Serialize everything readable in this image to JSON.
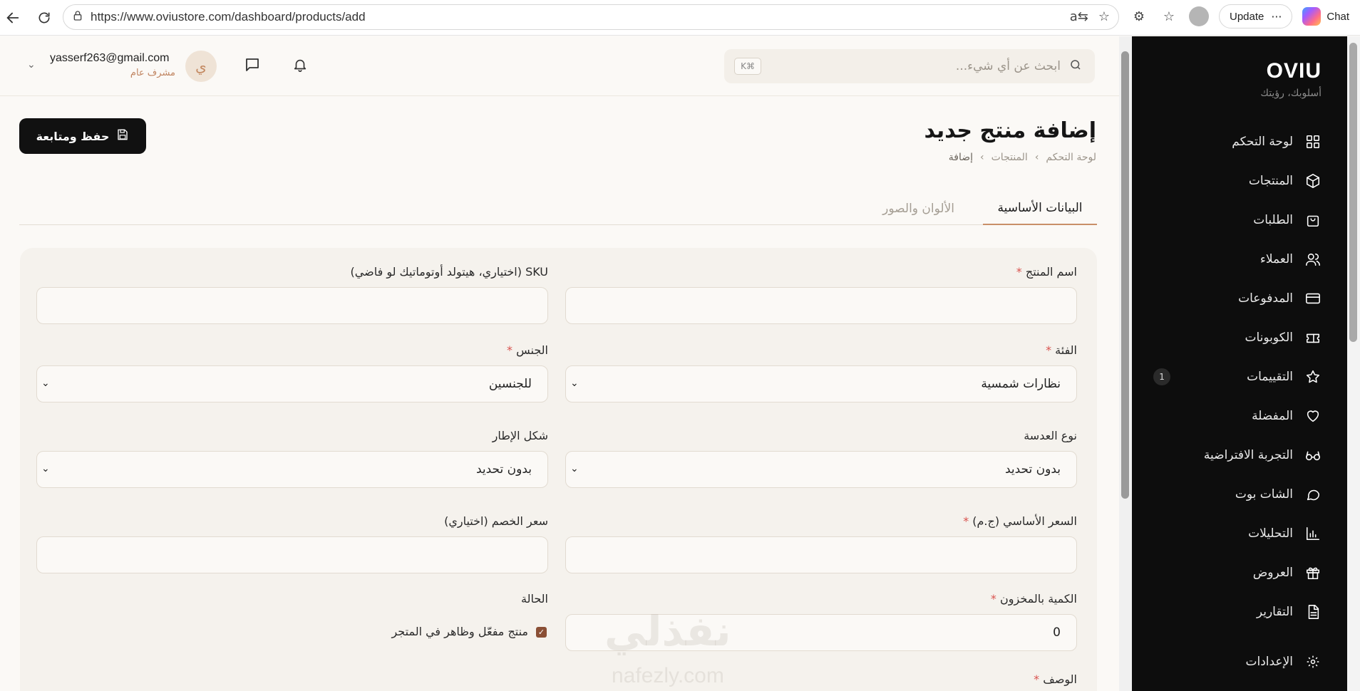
{
  "browser": {
    "url": "https://www.oviustore.com/dashboard/products/add",
    "update_label": "Update",
    "chat_label": "Chat"
  },
  "sidebar": {
    "brand": "OVIU",
    "tagline": "أسلوبك، رؤيتك",
    "items": [
      {
        "label": "لوحة التحكم",
        "icon": "grid-icon"
      },
      {
        "label": "المنتجات",
        "icon": "box-icon"
      },
      {
        "label": "الطلبات",
        "icon": "bag-icon"
      },
      {
        "label": "العملاء",
        "icon": "users-icon"
      },
      {
        "label": "المدفوعات",
        "icon": "card-icon"
      },
      {
        "label": "الكوبونات",
        "icon": "ticket-icon"
      },
      {
        "label": "التقييمات",
        "icon": "star-icon",
        "badge": "1"
      },
      {
        "label": "المفضلة",
        "icon": "heart-icon"
      },
      {
        "label": "التجربة الافتراضية",
        "icon": "glasses-icon"
      },
      {
        "label": "الشات بوت",
        "icon": "chat-icon"
      },
      {
        "label": "التحليلات",
        "icon": "bar-chart-icon"
      },
      {
        "label": "العروض",
        "icon": "gift-icon"
      },
      {
        "label": "التقارير",
        "icon": "file-icon"
      }
    ],
    "settings_label": "الإعدادات"
  },
  "topbar": {
    "search_placeholder": "ابحث عن أي شيء...",
    "kbd": "⌘K",
    "user_initial": "ي",
    "user_email": "yasserf263@gmail.com",
    "user_role": "مشرف عام"
  },
  "page": {
    "title": "إضافة منتج جديد",
    "breadcrumb": [
      "لوحة التحكم",
      "المنتجات",
      "إضافة"
    ],
    "save_label": "حفظ ومتابعة"
  },
  "tabs": {
    "basic": "البيانات الأساسية",
    "colors": "الألوان والصور"
  },
  "form": {
    "product_name_label": "اسم المنتج",
    "sku_label": "SKU (اختياري، هيتولد أوتوماتيك لو فاضي)",
    "category_label": "الفئة",
    "category_value": "نظارات شمسية",
    "gender_label": "الجنس",
    "gender_value": "للجنسين",
    "lens_label": "نوع العدسة",
    "lens_value": "بدون تحديد",
    "frame_label": "شكل الإطار",
    "frame_value": "بدون تحديد",
    "price_label": "السعر الأساسي (ج.م)",
    "discount_label": "سعر الخصم (اختياري)",
    "stock_label": "الكمية بالمخزون",
    "stock_value": "0",
    "status_label": "الحالة",
    "status_checkbox_label": "منتج مفعّل وظاهر في المتجر",
    "description_label": "الوصف"
  },
  "watermark": {
    "main": "نفذلي",
    "sub": "nafezly.com"
  }
}
